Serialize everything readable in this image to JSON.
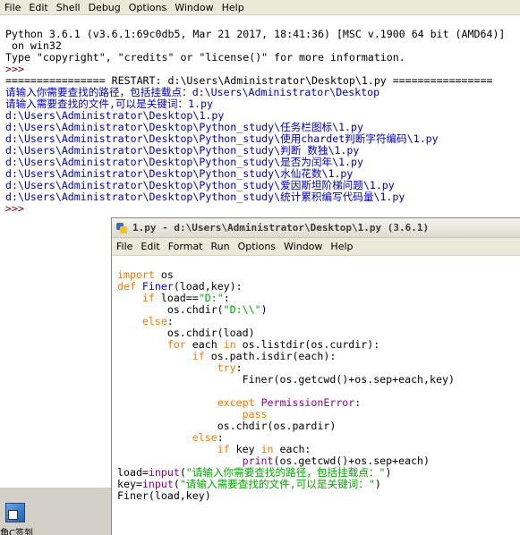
{
  "shell": {
    "menu": [
      "File",
      "Edit",
      "Shell",
      "Debug",
      "Options",
      "Window",
      "Help"
    ],
    "banner1": "Python 3.6.1 (v3.6.1:69c0db5, Mar 21 2017, 18:41:36) [MSC v.1900 64 bit (AMD64)]",
    "banner2": " on win32",
    "banner3": "Type \"copyright\", \"credits\" or \"license()\" for more information.",
    "prompt": ">>>",
    "restart": "================ RESTART: d:\\Users\\Administrator\\Desktop\\1.py ================",
    "input1": "请输入你需要查找的路径，包括挂载点：d:\\Users\\Administrator\\Desktop",
    "input2": "请输入需要查找的文件,可以是关键词：1.py",
    "results": [
      "d:\\Users\\Administrator\\Desktop\\1.py",
      "d:\\Users\\Administrator\\Desktop\\Python_study\\任务栏图标\\1.py",
      "d:\\Users\\Administrator\\Desktop\\Python_study\\使用chardet判断字符编码\\1.py",
      "d:\\Users\\Administrator\\Desktop\\Python_study\\判断 数独\\1.py",
      "d:\\Users\\Administrator\\Desktop\\Python_study\\是否为闰年\\1.py",
      "d:\\Users\\Administrator\\Desktop\\Python_study\\水仙花数\\1.py",
      "d:\\Users\\Administrator\\Desktop\\Python_study\\爱因斯坦阶梯问题\\1.py",
      "d:\\Users\\Administrator\\Desktop\\Python_study\\统计累积编写代码量\\1.py"
    ],
    "end_prompt": ">>>"
  },
  "desktop": {
    "icon_label": "角C签到",
    "icon_name": "app-shortcut-icon"
  },
  "editor": {
    "title": "1.py - d:\\Users\\Administrator\\Desktop\\1.py (3.6.1)",
    "menu": [
      "File",
      "Edit",
      "Format",
      "Run",
      "Options",
      "Window",
      "Help"
    ],
    "code": {
      "l1_kw": "import",
      "l1_rest": " os",
      "l2_kw": "def",
      "l2_fn": " Finer",
      "l2_rest": "(load,key):",
      "l3_ind": "    ",
      "l3_kw": "if",
      "l3_rest": " load==",
      "l3_str": "\"D:\"",
      "l3_end": ":",
      "l4_ind": "        ",
      "l4_rest": "os.chdir(",
      "l4_str": "\"D:\\\\\"",
      "l4_end": ")",
      "l5_ind": "    ",
      "l5_kw": "else",
      "l5_end": ":",
      "l6_ind": "        ",
      "l6_rest": "os.chdir(load)",
      "l7_ind": "        ",
      "l7_kw": "for",
      "l7_rest": " each ",
      "l7_kw2": "in",
      "l7_end": " os.listdir(os.curdir):",
      "l8_ind": "            ",
      "l8_kw": "if",
      "l8_end": " os.path.isdir(each):",
      "l9_ind": "                ",
      "l9_kw": "try",
      "l9_end": ":",
      "l10_ind": "                    ",
      "l10_rest": "Finer(os.getcwd()+os.sep+each,key)",
      "l11": "",
      "l12_ind": "                ",
      "l12_kw": "except",
      "l12_sp": " ",
      "l12_bi": "PermissionError",
      "l12_end": ":",
      "l13_ind": "                    ",
      "l13_kw": "pass",
      "l14_ind": "                ",
      "l14_rest": "os.chdir(os.pardir)",
      "l15_ind": "            ",
      "l15_kw": "else",
      "l15_end": ":",
      "l16_ind": "                ",
      "l16_kw": "if",
      "l16_rest": " key ",
      "l16_kw2": "in",
      "l16_end": " each:",
      "l17_ind": "                    ",
      "l17_bi": "print",
      "l17_end": "(os.getcwd()+os.sep+each)",
      "l18_rest": "load=",
      "l18_bi": "input",
      "l18_open": "(",
      "l18_str": "\"请输入你需要查找的路径，包括挂载点：\"",
      "l18_end": ")",
      "l19_rest": "key=",
      "l19_bi": "input",
      "l19_open": "(",
      "l19_str": "\"请输入需要查找的文件,可以是关键词：\"",
      "l19_end": ")",
      "l20_rest": "Finer(load,key)"
    }
  }
}
